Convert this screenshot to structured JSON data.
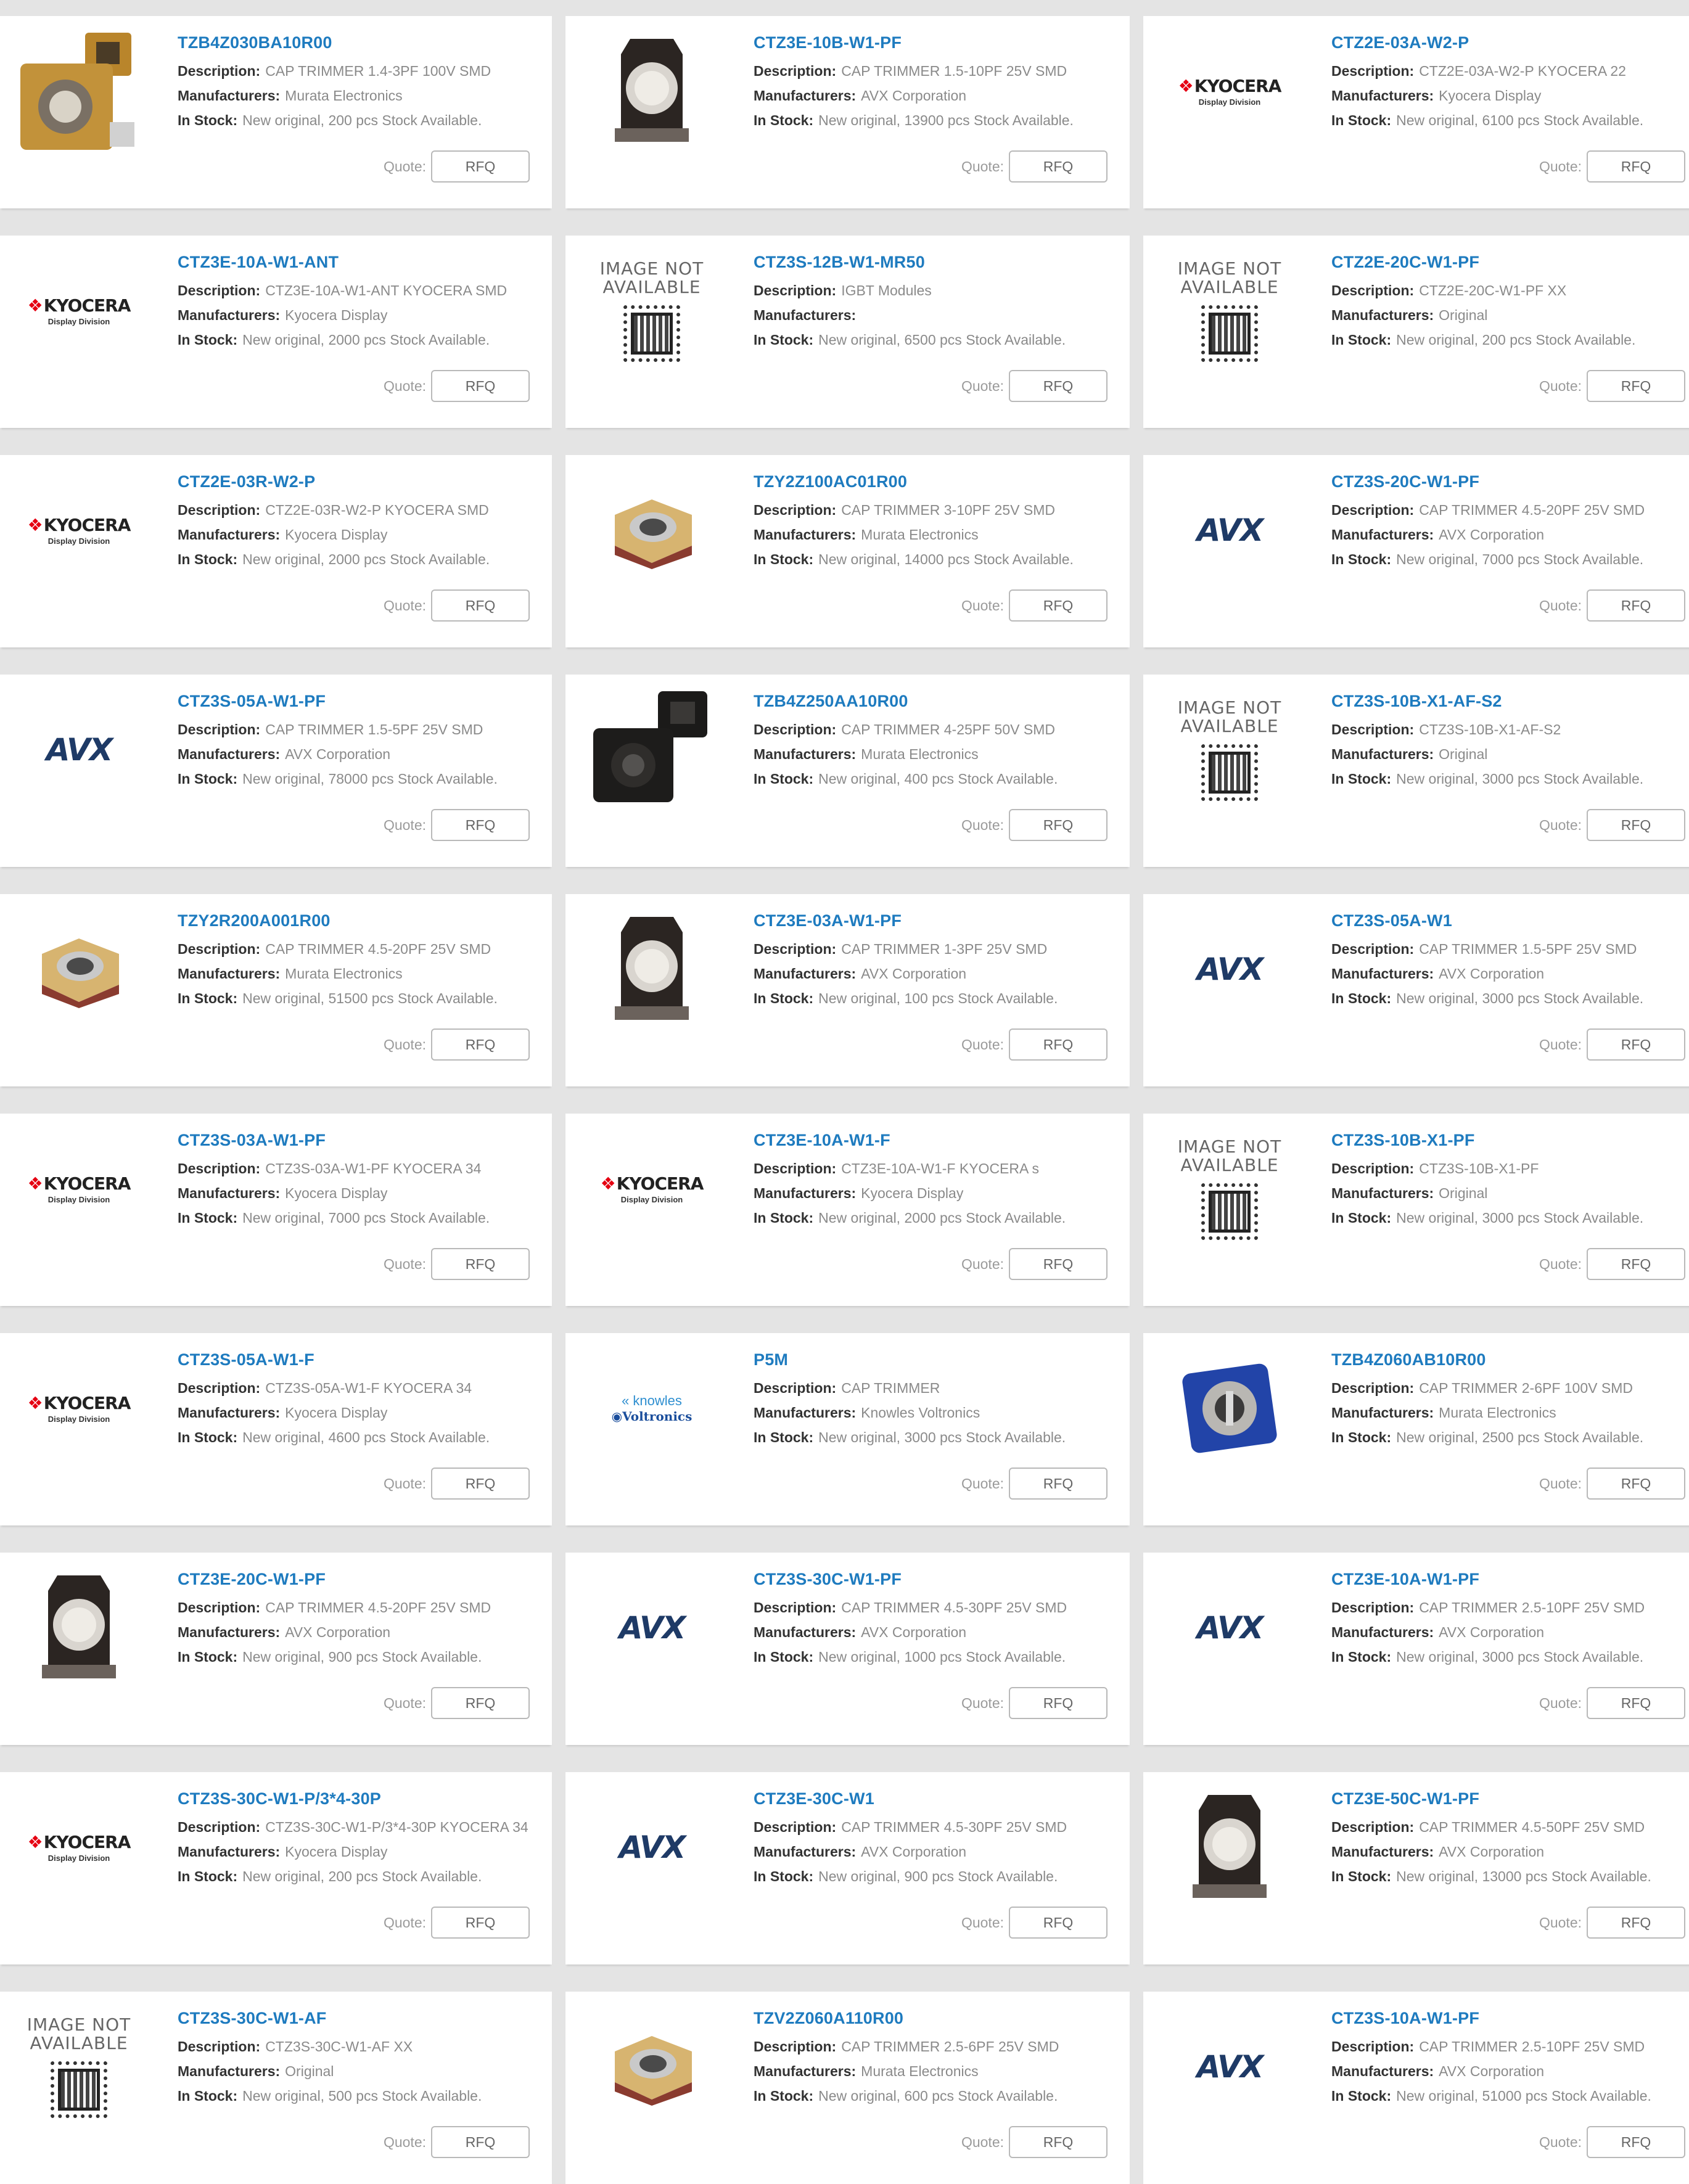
{
  "quote_label": "Quote:",
  "rfq_label": "RFQ",
  "field_labels": {
    "description": "Description:",
    "manufacturers": "Manufacturers:",
    "in_stock": "In Stock:"
  },
  "logo_text": {
    "kyocera": "KYOCERA",
    "kyocera_sub": "Display Division",
    "avx": "AVX",
    "knowles_1": "knowles",
    "knowles_2": "Voltronics",
    "image_not_available_1": "IMAGE NOT",
    "image_not_available_2": "AVAILABLE"
  },
  "products": [
    {
      "part": "TZB4Z030BA10R00",
      "desc": "CAP TRIMMER 1.4-3PF 100V SMD",
      "mfr": "Murata Electronics",
      "stock": "New original, 200 pcs Stock Available.",
      "image": "murata-gold-pair"
    },
    {
      "part": "CTZ3E-10B-W1-PF",
      "desc": "CAP TRIMMER 1.5-10PF 25V SMD",
      "mfr": "AVX Corporation",
      "stock": "New original, 13900 pcs Stock Available.",
      "image": "avx-black"
    },
    {
      "part": "CTZ2E-03A-W2-P",
      "desc": "CTZ2E-03A-W2-P KYOCERA 22",
      "mfr": "Kyocera Display",
      "stock": "New original, 6100 pcs Stock Available.",
      "image": "kyocera"
    },
    {
      "part": "CTZ3E-10A-W1-ANT",
      "desc": "CTZ3E-10A-W1-ANT KYOCERA SMD",
      "mfr": "Kyocera Display",
      "stock": "New original, 2000 pcs Stock Available.",
      "image": "kyocera"
    },
    {
      "part": "CTZ3S-12B-W1-MR50",
      "desc": "IGBT Modules",
      "mfr": "",
      "stock": "New original, 6500 pcs Stock Available.",
      "image": "na"
    },
    {
      "part": "CTZ2E-20C-W1-PF",
      "desc": "CTZ2E-20C-W1-PF XX",
      "mfr": "Original",
      "stock": "New original, 200 pcs Stock Available.",
      "image": "na"
    },
    {
      "part": "CTZ2E-03R-W2-P",
      "desc": "CTZ2E-03R-W2-P KYOCERA SMD",
      "mfr": "Kyocera Display",
      "stock": "New original, 2000 pcs Stock Available.",
      "image": "kyocera"
    },
    {
      "part": "TZY2Z100AC01R00",
      "desc": "CAP TRIMMER 3-10PF 25V SMD",
      "mfr": "Murata Electronics",
      "stock": "New original, 14000 pcs Stock Available.",
      "image": "murata-gold"
    },
    {
      "part": "CTZ3S-20C-W1-PF",
      "desc": "CAP TRIMMER 4.5-20PF 25V SMD",
      "mfr": "AVX Corporation",
      "stock": "New original, 7000 pcs Stock Available.",
      "image": "avx"
    },
    {
      "part": "CTZ3S-05A-W1-PF",
      "desc": "CAP TRIMMER 1.5-5PF 25V SMD",
      "mfr": "AVX Corporation",
      "stock": "New original, 78000 pcs Stock Available.",
      "image": "avx"
    },
    {
      "part": "TZB4Z250AA10R00",
      "desc": "CAP TRIMMER 4-25PF 50V SMD",
      "mfr": "Murata Electronics",
      "stock": "New original, 400 pcs Stock Available.",
      "image": "murata-black-pair"
    },
    {
      "part": "CTZ3S-10B-X1-AF-S2",
      "desc": "CTZ3S-10B-X1-AF-S2",
      "mfr": "Original",
      "stock": "New original, 3000 pcs Stock Available.",
      "image": "na"
    },
    {
      "part": "TZY2R200A001R00",
      "desc": "CAP TRIMMER 4.5-20PF 25V SMD",
      "mfr": "Murata Electronics",
      "stock": "New original, 51500 pcs Stock Available.",
      "image": "murata-gold"
    },
    {
      "part": "CTZ3E-03A-W1-PF",
      "desc": "CAP TRIMMER 1-3PF 25V SMD",
      "mfr": "AVX Corporation",
      "stock": "New original, 100 pcs Stock Available.",
      "image": "avx-black"
    },
    {
      "part": "CTZ3S-05A-W1",
      "desc": "CAP TRIMMER 1.5-5PF 25V SMD",
      "mfr": "AVX Corporation",
      "stock": "New original, 3000 pcs Stock Available.",
      "image": "avx"
    },
    {
      "part": "CTZ3S-03A-W1-PF",
      "desc": "CTZ3S-03A-W1-PF KYOCERA 34",
      "mfr": "Kyocera Display",
      "stock": "New original, 7000 pcs Stock Available.",
      "image": "kyocera"
    },
    {
      "part": "CTZ3E-10A-W1-F",
      "desc": "CTZ3E-10A-W1-F KYOCERA s",
      "mfr": "Kyocera Display",
      "stock": "New original, 2000 pcs Stock Available.",
      "image": "kyocera"
    },
    {
      "part": "CTZ3S-10B-X1-PF",
      "desc": "CTZ3S-10B-X1-PF",
      "mfr": "Original",
      "stock": "New original, 3000 pcs Stock Available.",
      "image": "na"
    },
    {
      "part": "CTZ3S-05A-W1-F",
      "desc": "CTZ3S-05A-W1-F KYOCERA 34",
      "mfr": "Kyocera Display",
      "stock": "New original, 4600 pcs Stock Available.",
      "image": "kyocera"
    },
    {
      "part": "P5M",
      "desc": "CAP TRIMMER",
      "mfr": "Knowles Voltronics",
      "stock": "New original, 3000 pcs Stock Available.",
      "image": "knowles"
    },
    {
      "part": "TZB4Z060AB10R00",
      "desc": "CAP TRIMMER 2-6PF 100V SMD",
      "mfr": "Murata Electronics",
      "stock": "New original, 2500 pcs Stock Available.",
      "image": "murata-blue"
    },
    {
      "part": "CTZ3E-20C-W1-PF",
      "desc": "CAP TRIMMER 4.5-20PF 25V SMD",
      "mfr": "AVX Corporation",
      "stock": "New original, 900 pcs Stock Available.",
      "image": "avx-black"
    },
    {
      "part": "CTZ3S-30C-W1-PF",
      "desc": "CAP TRIMMER 4.5-30PF 25V SMD",
      "mfr": "AVX Corporation",
      "stock": "New original, 1000 pcs Stock Available.",
      "image": "avx"
    },
    {
      "part": "CTZ3E-10A-W1-PF",
      "desc": "CAP TRIMMER 2.5-10PF 25V SMD",
      "mfr": "AVX Corporation",
      "stock": "New original, 3000 pcs Stock Available.",
      "image": "avx"
    },
    {
      "part": "CTZ3S-30C-W1-P/3*4-30P",
      "desc": "CTZ3S-30C-W1-P/3*4-30P KYOCERA 34",
      "mfr": "Kyocera Display",
      "stock": "New original, 200 pcs Stock Available.",
      "image": "kyocera"
    },
    {
      "part": "CTZ3E-30C-W1",
      "desc": "CAP TRIMMER 4.5-30PF 25V SMD",
      "mfr": "AVX Corporation",
      "stock": "New original, 900 pcs Stock Available.",
      "image": "avx"
    },
    {
      "part": "CTZ3E-50C-W1-PF",
      "desc": "CAP TRIMMER 4.5-50PF 25V SMD",
      "mfr": "AVX Corporation",
      "stock": "New original, 13000 pcs Stock Available.",
      "image": "avx-black"
    },
    {
      "part": "CTZ3S-30C-W1-AF",
      "desc": "CTZ3S-30C-W1-AF XX",
      "mfr": "Original",
      "stock": "New original, 500 pcs Stock Available.",
      "image": "na"
    },
    {
      "part": "TZV2Z060A110R00",
      "desc": "CAP TRIMMER 2.5-6PF 25V SMD",
      "mfr": "Murata Electronics",
      "stock": "New original, 600 pcs Stock Available.",
      "image": "murata-gold"
    },
    {
      "part": "CTZ3S-10A-W1-PF",
      "desc": "CAP TRIMMER 2.5-10PF 25V SMD",
      "mfr": "AVX Corporation",
      "stock": "New original, 51000 pcs Stock Available.",
      "image": "avx"
    }
  ]
}
